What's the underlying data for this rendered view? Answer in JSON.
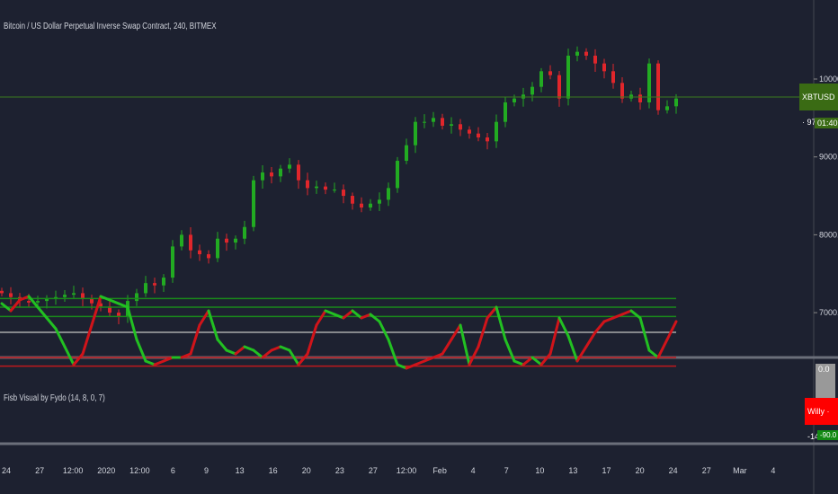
{
  "header": {
    "title": "Bitcoin / US Dollar Perpetual Inverse Swap Contract, 240, BITMEX"
  },
  "price_axis": {
    "ticks": [
      "10000.0",
      "9000.0",
      "8000.0",
      "7000.0"
    ],
    "last_label": "XBTUSD · 9745.5",
    "countdown": "01:40:13",
    "last_price": 9745.5
  },
  "indicator": {
    "title": "Fisb Visual by Fydo (14, 8, 0, 7)",
    "axis_top": "0.0",
    "value_label": "Willy · -14.2",
    "axis_bottom": "-90.0",
    "levels_red": [
      -3,
      -15
    ],
    "level_mid": -50,
    "levels_green": [
      -72,
      -85,
      -97
    ]
  },
  "time_axis": {
    "labels": [
      "24",
      "27",
      "12:00",
      "2020",
      "12:00",
      "6",
      "9",
      "13",
      "16",
      "20",
      "23",
      "27",
      "12:00",
      "Feb",
      "4",
      "7",
      "10",
      "13",
      "17",
      "20",
      "24",
      "27",
      "Mar",
      "4"
    ]
  },
  "colors": {
    "background": "#1d2130",
    "up": "#22ab22",
    "down": "#e0262b",
    "grid": "#2a2e39"
  },
  "chart_data": {
    "type": "candlestick",
    "closes": [
      7250,
      7200,
      7150,
      7130,
      7150,
      7180,
      7200,
      7230,
      7250,
      7180,
      7120,
      7080,
      7000,
      6950,
      7150,
      7250,
      7380,
      7350,
      7450,
      7850,
      8000,
      7800,
      7750,
      7700,
      7950,
      7900,
      7950,
      8100,
      8700,
      8800,
      8750,
      8850,
      8900,
      8700,
      8600,
      8620,
      8580,
      8580,
      8500,
      8400,
      8350,
      8400,
      8450,
      8600,
      8950,
      9150,
      9450,
      9450,
      9500,
      9400,
      9420,
      9350,
      9300,
      9250,
      9200,
      9450,
      9700,
      9750,
      9800,
      9900,
      10100,
      10050,
      9750,
      10300,
      10350,
      10300,
      10200,
      10100,
      9950,
      9750,
      9800,
      9700,
      10200,
      9600,
      9650,
      9750
    ],
    "ylim": [
      6500,
      10700
    ],
    "oscillator": [
      -90,
      -80,
      -95,
      -100,
      -85,
      -70,
      -55,
      -30,
      -5,
      -20,
      -60,
      -100,
      -95,
      -90,
      -85,
      -40,
      -10,
      -5,
      -10,
      -15,
      -15,
      -20,
      -60,
      -80,
      -40,
      -25,
      -20,
      -30,
      -25,
      -15,
      -25,
      -30,
      -25,
      -5,
      -20,
      -60,
      -80,
      -75,
      -70,
      -80,
      -70,
      -75,
      -65,
      -40,
      -5,
      0,
      -5,
      -10,
      -15,
      -20,
      -40,
      -60,
      -5,
      -30,
      -70,
      -85,
      -40,
      -10,
      -5,
      -15,
      -5,
      -20,
      -70,
      -45,
      -10,
      -30,
      -50,
      -65,
      -70,
      -75,
      -80,
      -70,
      -25,
      -15,
      -40,
      -65
    ],
    "oscillator_ylim": [
      -100,
      0
    ]
  }
}
